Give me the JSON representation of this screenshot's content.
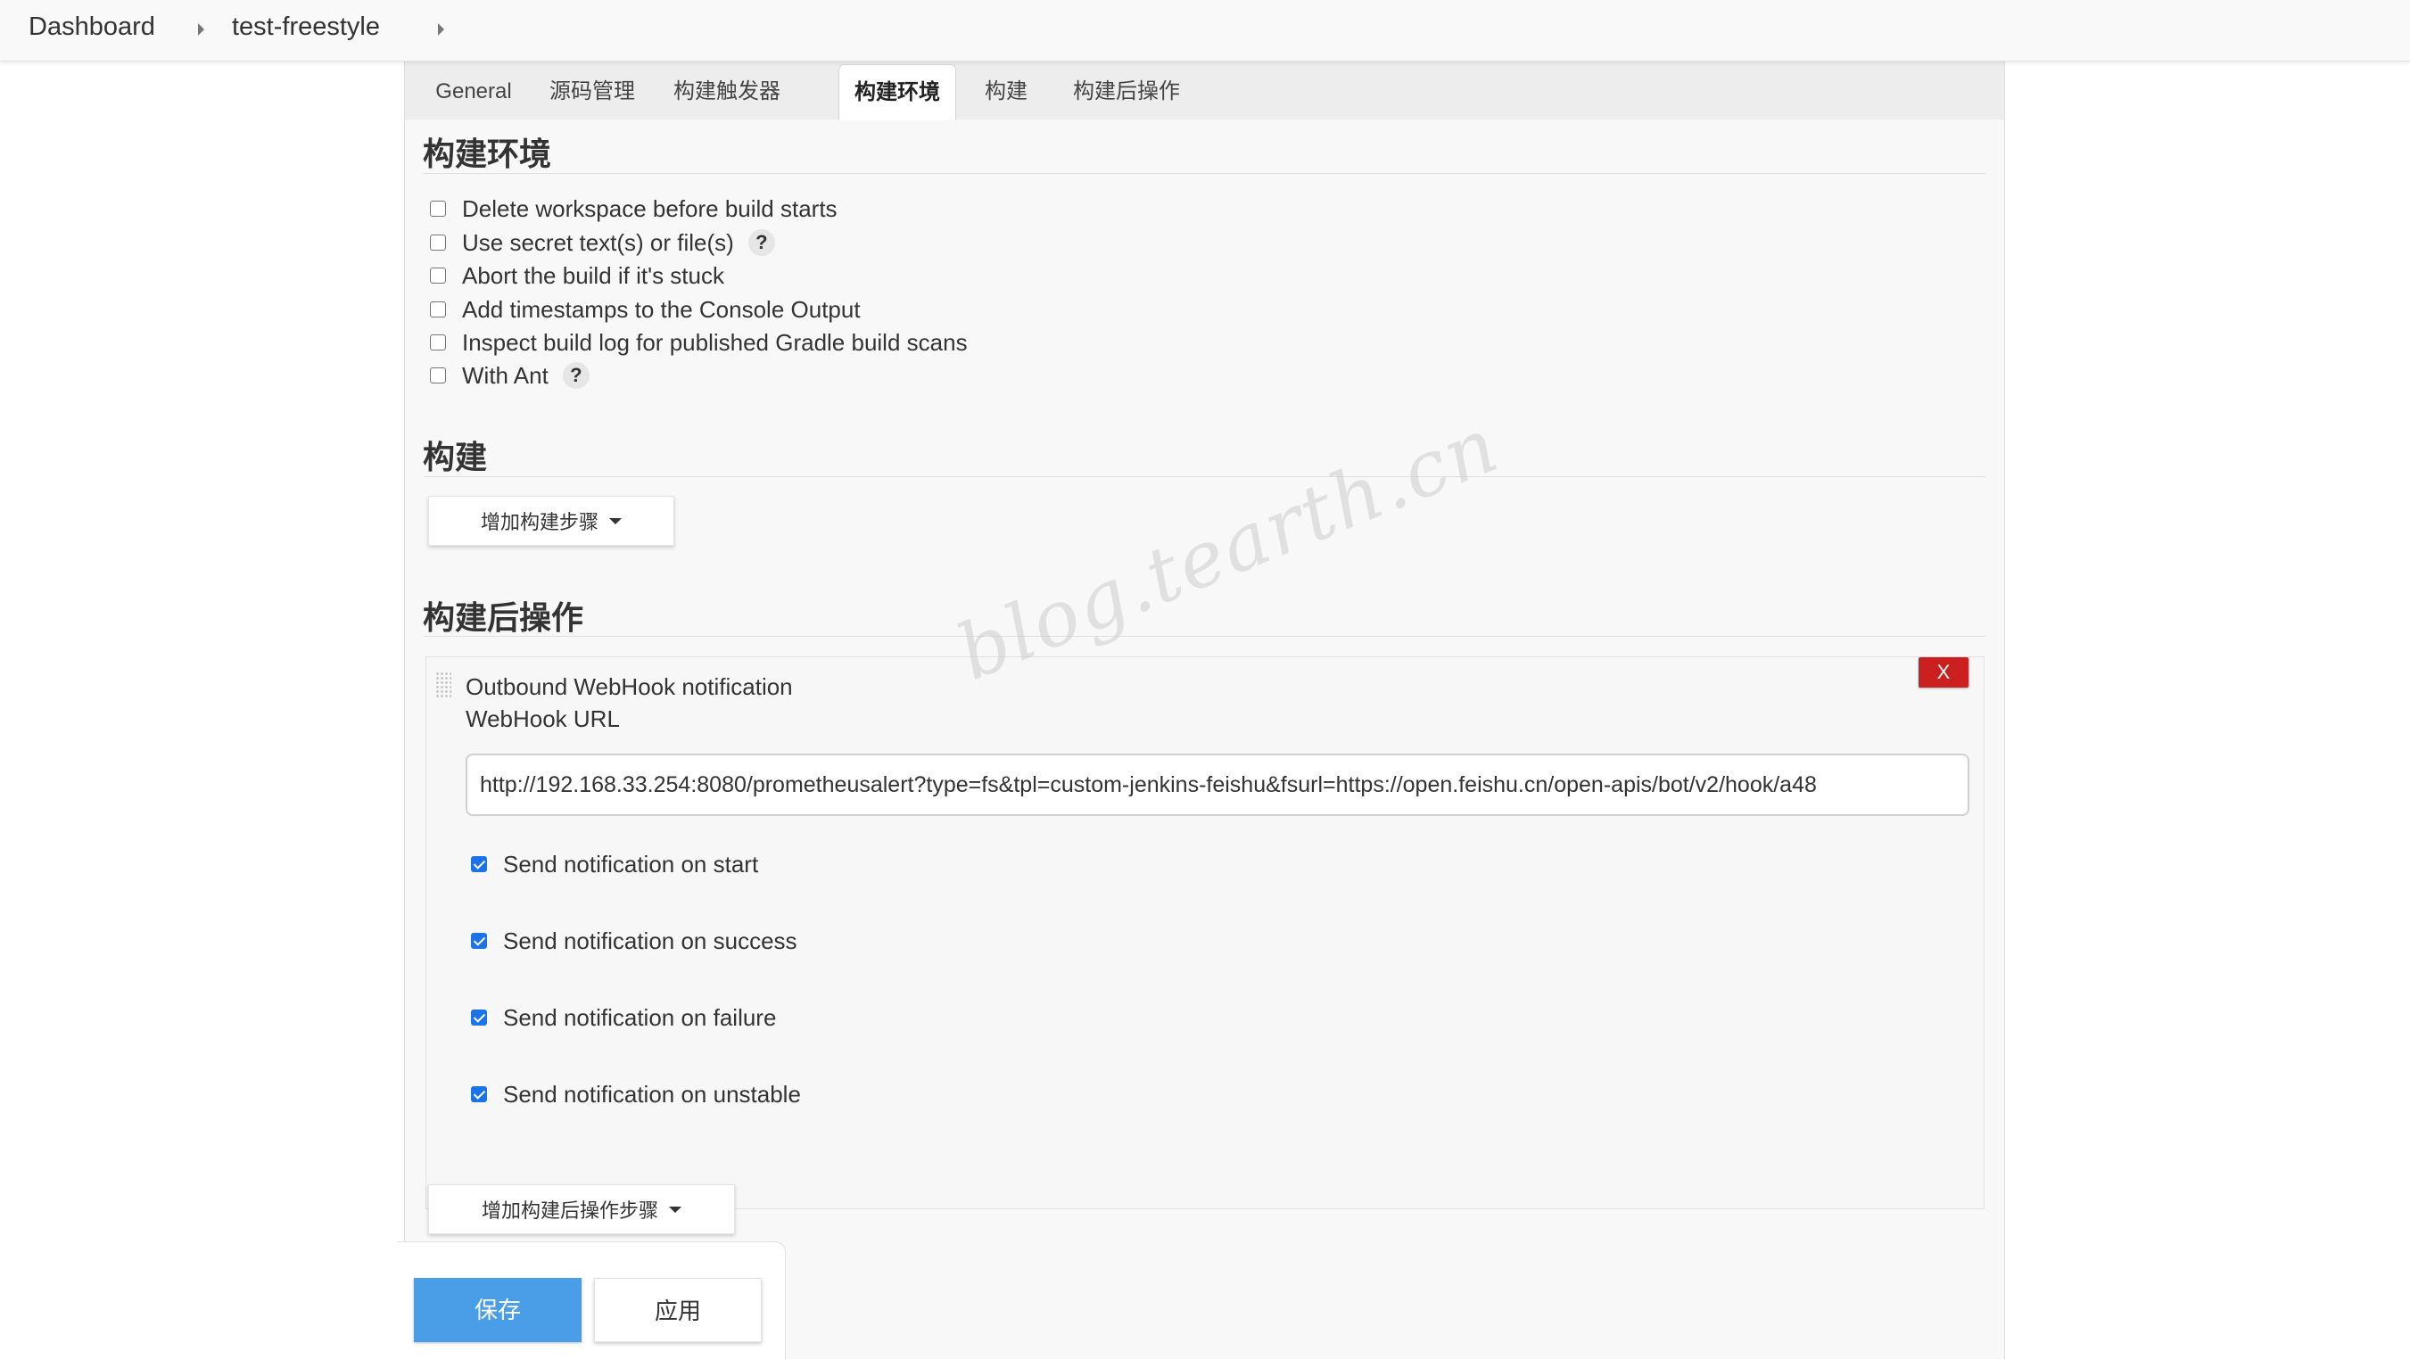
{
  "breadcrumb": {
    "items": [
      {
        "label": "Dashboard"
      },
      {
        "label": "test-freestyle"
      }
    ]
  },
  "tabs": [
    {
      "label": "General"
    },
    {
      "label": "源码管理"
    },
    {
      "label": "构建触发器"
    },
    {
      "label": "构建环境",
      "active": true
    },
    {
      "label": "构建"
    },
    {
      "label": "构建后操作"
    }
  ],
  "build_env": {
    "title": "构建环境",
    "options": [
      {
        "label": "Delete workspace before build starts",
        "checked": false,
        "help": false
      },
      {
        "label": "Use secret text(s) or file(s)",
        "checked": false,
        "help": true
      },
      {
        "label": "Abort the build if it's stuck",
        "checked": false,
        "help": false
      },
      {
        "label": "Add timestamps to the Console Output",
        "checked": false,
        "help": false
      },
      {
        "label": "Inspect build log for published Gradle build scans",
        "checked": false,
        "help": false
      },
      {
        "label": "With Ant",
        "checked": false,
        "help": true
      }
    ],
    "help_glyph": "?"
  },
  "build": {
    "title": "构建",
    "add_step_label": "增加构建步骤"
  },
  "post_build": {
    "title": "构建后操作",
    "webhook": {
      "title": "Outbound WebHook notification",
      "url_label": "WebHook URL",
      "url_value": "http://192.168.33.254:8080/prometheusalert?type=fs&tpl=custom-jenkins-feishu&fsurl=https://open.feishu.cn/open-apis/bot/v2/hook/a48",
      "delete_label": "X",
      "notifications": [
        {
          "label": "Send notification on start",
          "checked": true
        },
        {
          "label": "Send notification on success",
          "checked": true
        },
        {
          "label": "Send notification on failure",
          "checked": true
        },
        {
          "label": "Send notification on unstable",
          "checked": true
        }
      ]
    },
    "add_step_label": "增加构建后操作步骤"
  },
  "actions": {
    "save_label": "保存",
    "apply_label": "应用"
  },
  "watermark": "blog.tearth.cn",
  "colors": {
    "primary": "#4a9ee8",
    "danger": "#cc2020",
    "checkbox": "#1a73e8"
  }
}
